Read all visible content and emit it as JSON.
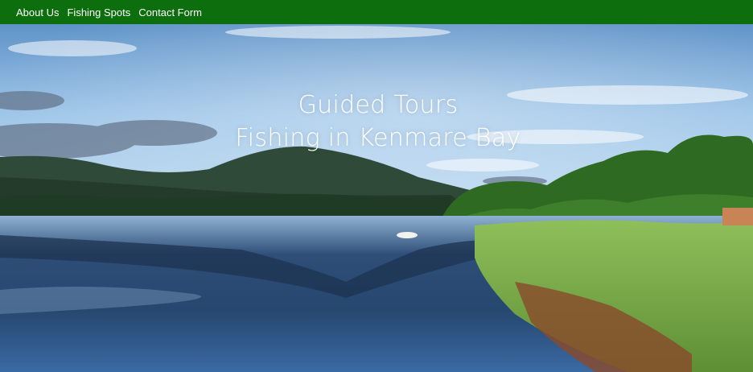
{
  "nav": {
    "items": [
      {
        "label": "About Us"
      },
      {
        "label": "Fishing Spots"
      },
      {
        "label": "Contact Form"
      }
    ]
  },
  "hero": {
    "title_line1": "Guided Tours",
    "title_line2": "Fishing in Kenmare Bay"
  },
  "colors": {
    "nav_background": "#0d6e0d",
    "hero_text": "#ffffff"
  }
}
